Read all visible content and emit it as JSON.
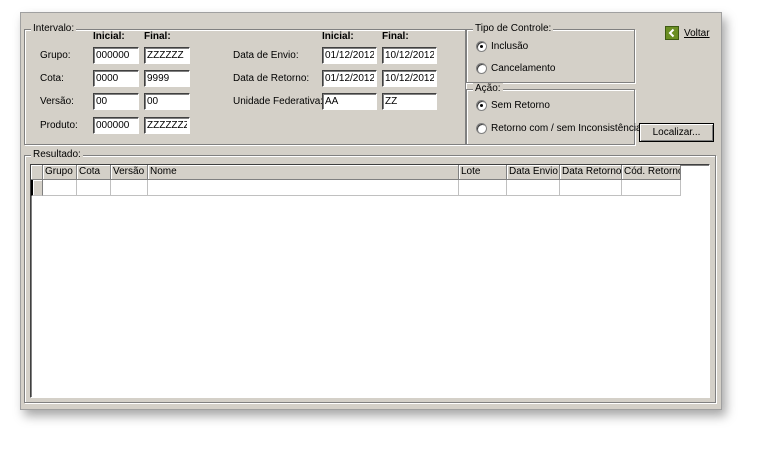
{
  "intervalo": {
    "legend": "Intervalo:",
    "col_inicial": "Inicial:",
    "col_final": "Final:",
    "rows": [
      {
        "label": "Grupo:",
        "inicial": "000000",
        "final": "ZZZZZZ"
      },
      {
        "label": "Cota:",
        "inicial": "0000",
        "final": "9999"
      },
      {
        "label": "Versão:",
        "inicial": "00",
        "final": "00"
      },
      {
        "label": "Produto:",
        "inicial": "000000",
        "final": "ZZZZZZZ"
      }
    ],
    "col_inicial2": "Inicial:",
    "col_final2": "Final:",
    "rows2": [
      {
        "label": "Data de Envio:",
        "inicial": "01/12/2012",
        "final": "10/12/2012"
      },
      {
        "label": "Data de Retorno:",
        "inicial": "01/12/2012",
        "final": "10/12/2012"
      },
      {
        "label": "Unidade Federativa:",
        "inicial": "AA",
        "final": "ZZ"
      }
    ]
  },
  "tipo_controle": {
    "legend": "Tipo de Controle:",
    "options": [
      "Inclusão",
      "Cancelamento"
    ],
    "selected": 0
  },
  "acao": {
    "legend": "Ação:",
    "options": [
      "Sem Retorno",
      "Retorno com / sem Inconsistência"
    ],
    "selected": 0
  },
  "voltar_label": "Voltar",
  "localizar_label": "Localizar...",
  "resultado": {
    "legend": "Resultado:",
    "columns": [
      "Grupo",
      "Cota",
      "Versão",
      "Nome",
      "Lote",
      "Data Envio",
      "Data Retorno",
      "Cód. Retorno"
    ]
  }
}
